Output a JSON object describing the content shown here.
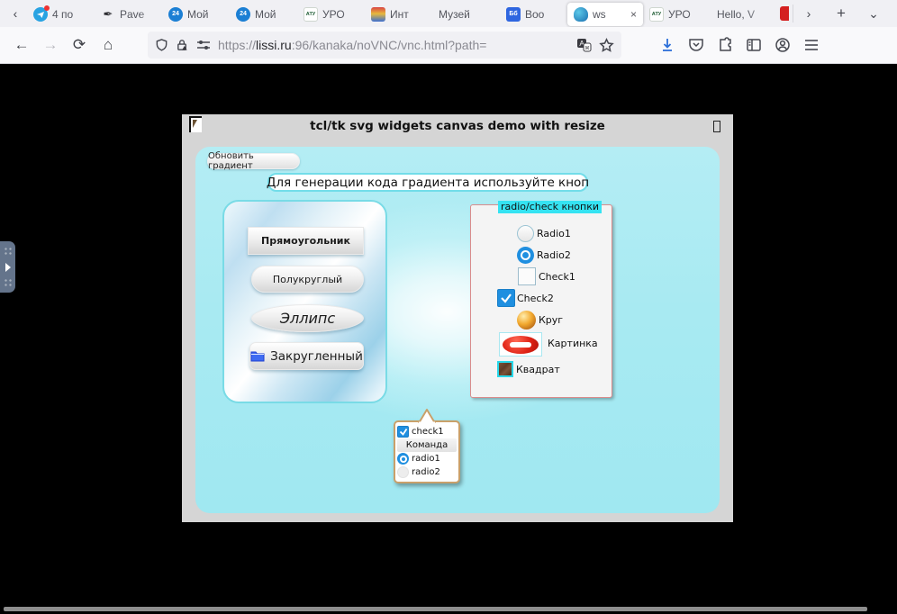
{
  "browser": {
    "tab_strip": {
      "scroll_left": "‹",
      "scroll_right": "›",
      "new_tab": "+",
      "list_tabs": "⌄",
      "tabs": [
        {
          "label": "4 по",
          "icon": "telegram"
        },
        {
          "label": "Pave",
          "icon": "quill"
        },
        {
          "label": "Мой",
          "icon": "cloud24",
          "icon_text": "24"
        },
        {
          "label": "Мой",
          "icon": "cloud24",
          "icon_text": "24"
        },
        {
          "label": "УРО",
          "icon": "atu",
          "icon_text": "АТУ"
        },
        {
          "label": "Инт",
          "icon": "emblem"
        },
        {
          "label": "Музей",
          "icon": "none"
        },
        {
          "label": "Boo",
          "icon": "books",
          "icon_text": "Бб"
        },
        {
          "label": "ws",
          "icon": "wscloud",
          "active": true,
          "close": "×"
        },
        {
          "label": "УРО",
          "icon": "atu",
          "icon_text": "АТУ"
        },
        {
          "label": "Hello, V",
          "icon": "none"
        }
      ]
    },
    "nav": {
      "back": "←",
      "forward": "→",
      "reload": "⟳",
      "home": "⌂",
      "url_scheme": "https://",
      "url_domain": "lissi.ru",
      "url_rest": ":96/kanaka/noVNC/vnc.html?path="
    }
  },
  "vnc": {
    "window_title": "tcl/tk svg widgets canvas demo with resize",
    "refresh_button": "Обновить градиент",
    "message": "Для генерации кода градиента используйте кноп",
    "shape_buttons": [
      {
        "label": "Прямоугольник"
      },
      {
        "label": "Полукруглый"
      },
      {
        "label": "Эллипс"
      },
      {
        "label": "Закругленный"
      }
    ],
    "rc_panel": {
      "title": "radio/check кнопки",
      "items": [
        {
          "label": "Radio1",
          "type": "radio",
          "checked": false
        },
        {
          "label": "Radio2",
          "type": "radio",
          "checked": true
        },
        {
          "label": "Check1",
          "type": "checkbox",
          "checked": false
        },
        {
          "label": "Check2",
          "type": "checkbox",
          "checked": true
        },
        {
          "label": "Круг",
          "type": "sphere-image"
        },
        {
          "label": "Картинка",
          "type": "picture"
        },
        {
          "label": "Квадрат",
          "type": "square-image"
        }
      ]
    },
    "popup": {
      "items": [
        {
          "label": "check1",
          "type": "checkbox",
          "checked": true
        },
        {
          "label": "Команда",
          "type": "command"
        },
        {
          "label": "radio1",
          "type": "radio",
          "checked": true
        },
        {
          "label": "radio2",
          "type": "radio",
          "checked": false
        }
      ]
    },
    "colors": {
      "accent_blue": "#1f8fe0",
      "canvas_cyan": "#a8eaf2",
      "panel_label_bg": "#35e3f2",
      "popup_border": "#c9a06a",
      "rc_panel_border": "#d98c8c"
    }
  }
}
